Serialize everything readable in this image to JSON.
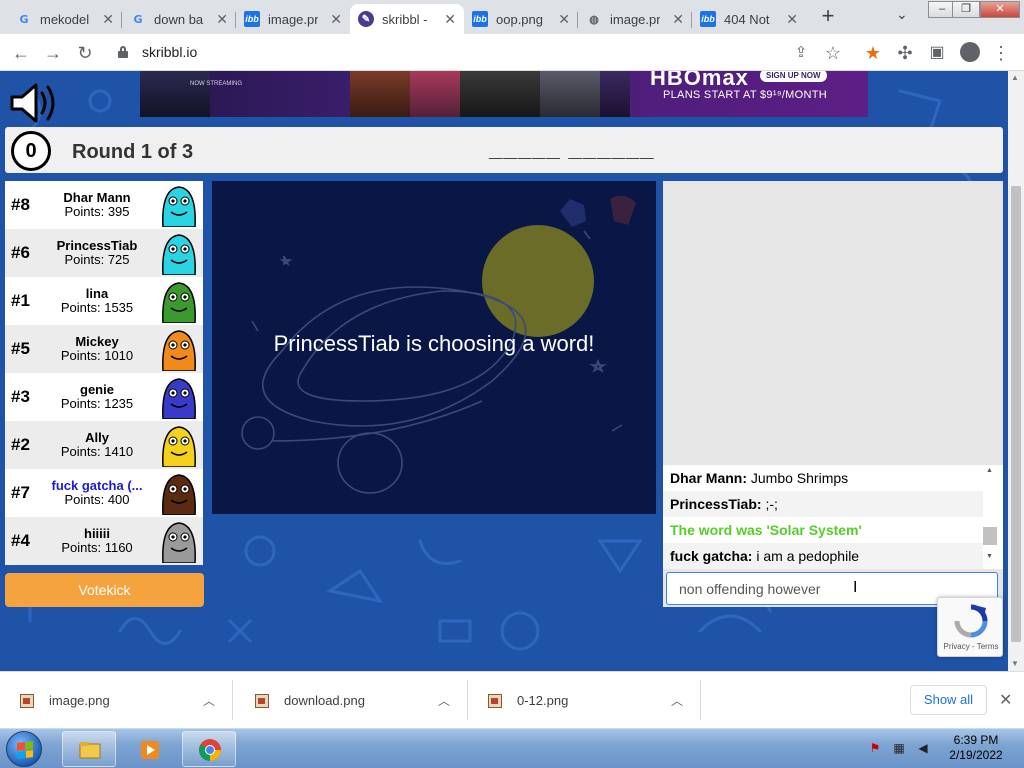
{
  "browser": {
    "tabs": [
      {
        "title": "mekodelli",
        "icon": "google-icon"
      },
      {
        "title": "down ba",
        "icon": "google-icon"
      },
      {
        "title": "image.pn",
        "icon": "imgbb-icon"
      },
      {
        "title": "skribbl -",
        "icon": "skribbl-icon",
        "active": true
      },
      {
        "title": "oop.png",
        "icon": "imgbb-icon"
      },
      {
        "title": "image.pn",
        "icon": "globe-icon"
      },
      {
        "title": "404 Not",
        "icon": "imgbb-icon"
      }
    ],
    "url": "skribbl.io"
  },
  "ad": {
    "brand": "HBOmax",
    "signup": "SIGN UP NOW",
    "plans": "PLANS START AT $9¹⁹/MONTH",
    "streaming": "NOW STREAMING"
  },
  "game": {
    "clock": "0",
    "round": "Round 1 of 3",
    "word_hint": "_____ ______",
    "canvas_message": "PrincessTiab is choosing a word!",
    "votekick_label": "Votekick"
  },
  "players": [
    {
      "rank": "#8",
      "name": "Dhar Mann",
      "points": "Points: 395",
      "color": "#2ad4e0"
    },
    {
      "rank": "#6",
      "name": "PrincessTiab",
      "points": "Points: 725",
      "color": "#2ad4e0"
    },
    {
      "rank": "#1",
      "name": "lina",
      "points": "Points: 1535",
      "color": "#3a9a2e"
    },
    {
      "rank": "#5",
      "name": "Mickey",
      "points": "Points: 1010",
      "color": "#f08a1c"
    },
    {
      "rank": "#3",
      "name": "genie",
      "points": "Points: 1235",
      "color": "#3a3ac8"
    },
    {
      "rank": "#2",
      "name": "Ally",
      "points": "Points: 1410",
      "color": "#f4d21c"
    },
    {
      "rank": "#7",
      "name": "fuck gatcha (...",
      "points": "Points: 400",
      "color": "#5a2a12",
      "me": true
    },
    {
      "rank": "#4",
      "name": "hiiiii",
      "points": "Points: 1160",
      "color": "#9a9a9a"
    }
  ],
  "chat": {
    "messages": [
      {
        "sender": "Dhar Mann:",
        "text": "Jumbo Shrimps"
      },
      {
        "sender": "PrincessTiab:",
        "text": ";-;"
      },
      {
        "system": "The word was 'Solar System'"
      },
      {
        "sender": "fuck gatcha:",
        "text": "i am a pedophile"
      }
    ],
    "input_value": "non offending however",
    "recaptcha_links": "Privacy - Terms"
  },
  "downloads": {
    "items": [
      "image.png",
      "download.png",
      "0-12.png"
    ],
    "show_all": "Show all"
  },
  "taskbar": {
    "time": "6:39 PM",
    "date": "2/19/2022"
  },
  "colors": {
    "page_bg": "#1f53a8",
    "canvas_bg": "#0a1646",
    "votekick": "#f5a33f",
    "correct_guess": "#56ce27"
  }
}
